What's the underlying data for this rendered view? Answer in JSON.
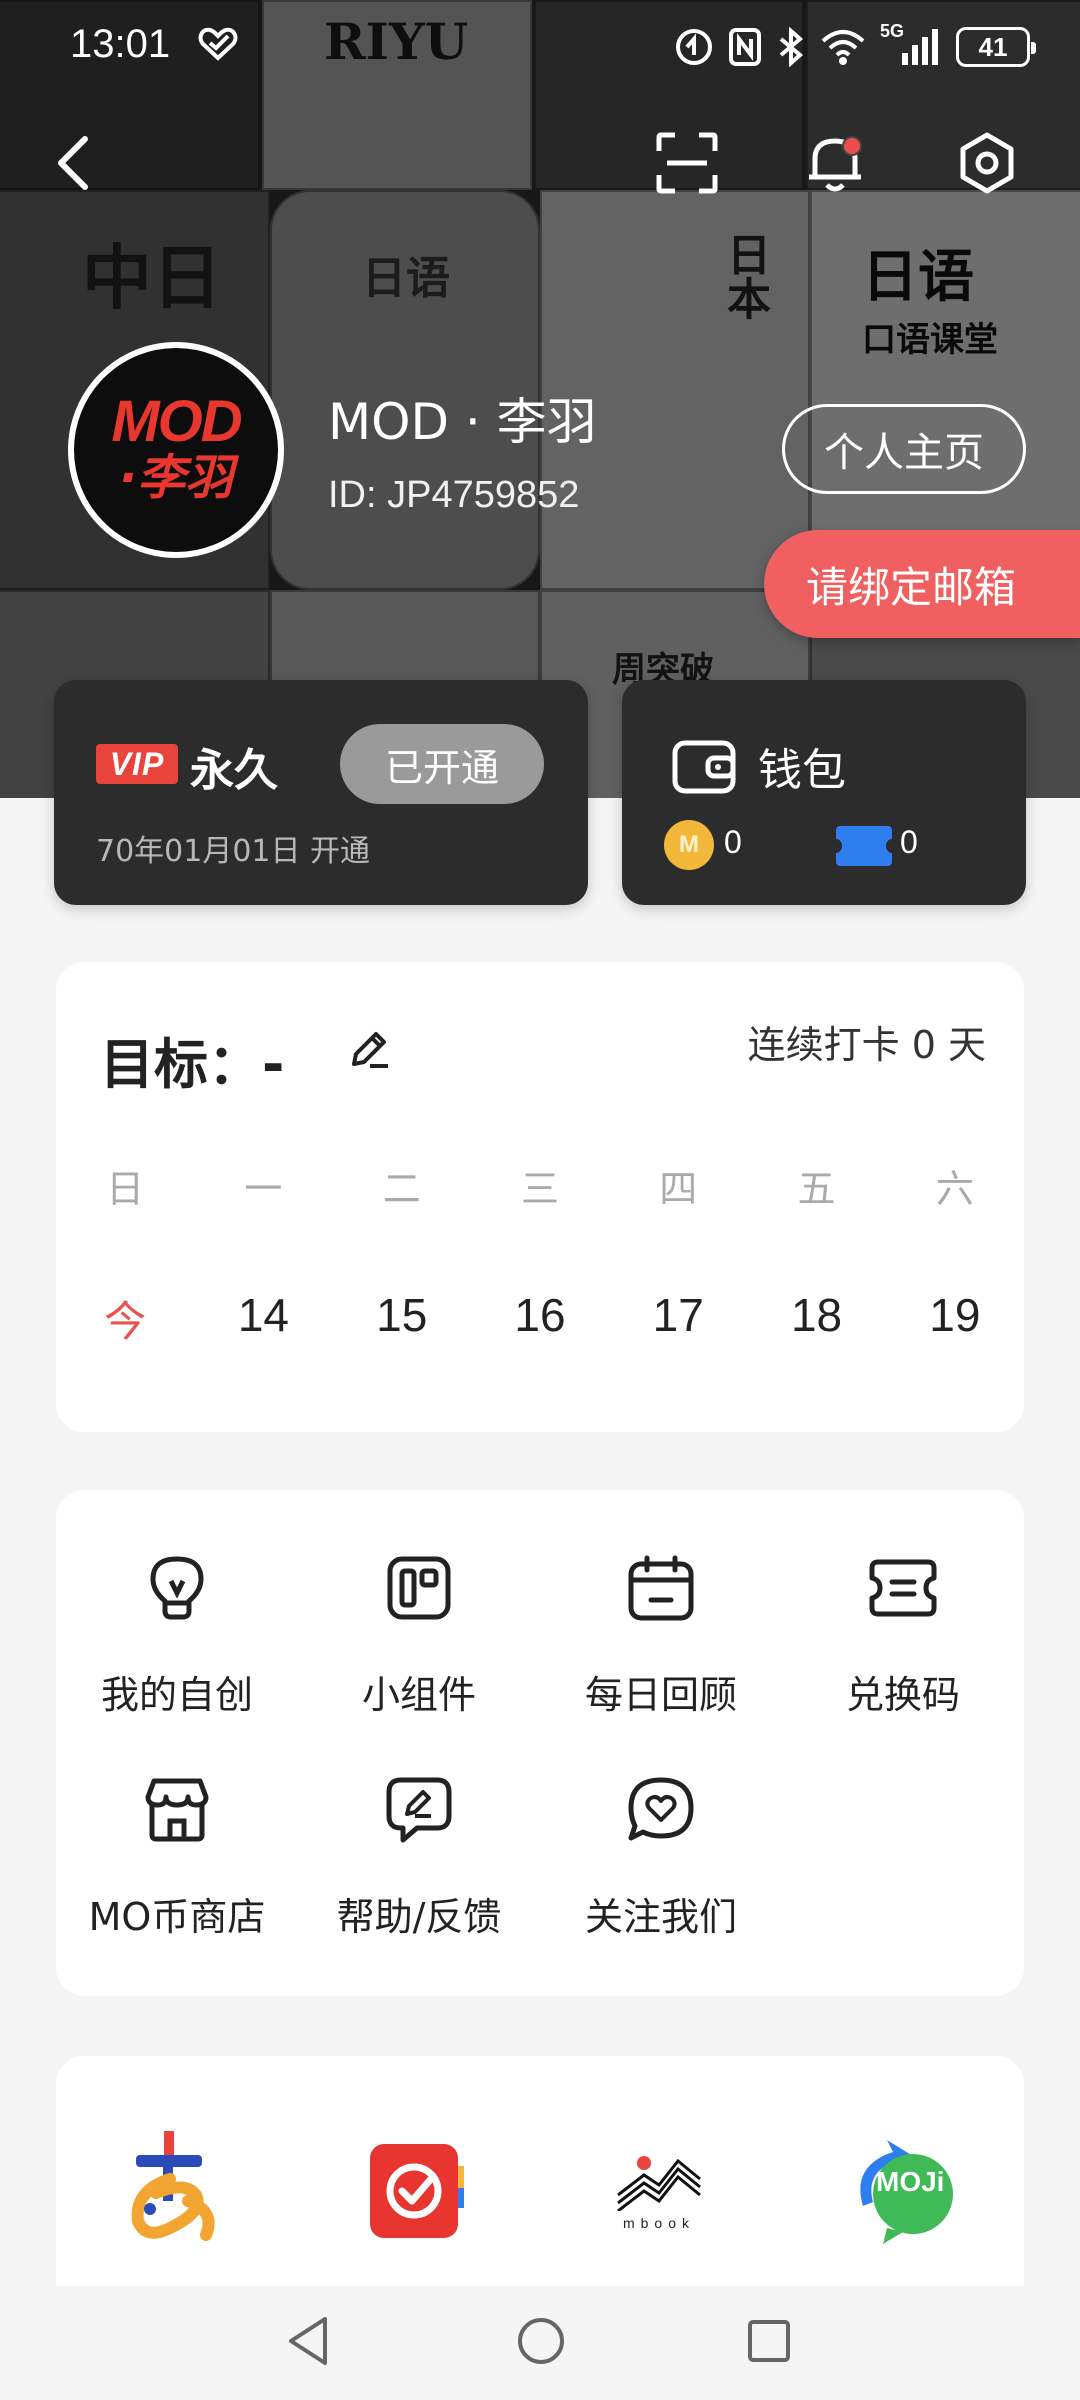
{
  "status_bar": {
    "time": "13:01",
    "network": "5G",
    "battery": "41"
  },
  "profile": {
    "avatar_line1": "MOD",
    "avatar_line2": "·李羽",
    "name": "MOD · 李羽",
    "id": "ID: JP4759852",
    "homepage_button": "个人主页",
    "bind_email_button": "请绑定邮箱"
  },
  "background_covers": [
    "RIYU",
    "日语",
    "中日",
    "日本",
    "日语",
    "口语课堂",
    "周突破"
  ],
  "vip": {
    "badge": "VIP",
    "term": "永久",
    "status": "已开通",
    "activation": "70年01月01日 开通"
  },
  "wallet": {
    "title": "钱包",
    "coin_symbol": "M",
    "coins": "0",
    "tickets": "0"
  },
  "goal": {
    "title": "目标：",
    "value": "-",
    "streak": "连续打卡 0 天",
    "weekdays": [
      "日",
      "一",
      "二",
      "三",
      "四",
      "五",
      "六"
    ],
    "dates": [
      "今",
      "14",
      "15",
      "16",
      "17",
      "18",
      "19"
    ]
  },
  "features": [
    {
      "label": "我的自创",
      "icon": "lightbulb-icon"
    },
    {
      "label": "小组件",
      "icon": "widget-icon"
    },
    {
      "label": "每日回顾",
      "icon": "calendar-icon"
    },
    {
      "label": "兑换码",
      "icon": "ticket-icon"
    },
    {
      "label": "MO币商店",
      "icon": "store-icon"
    },
    {
      "label": "帮助/反馈",
      "icon": "feedback-icon"
    },
    {
      "label": "关注我们",
      "icon": "heart-chat-icon"
    }
  ],
  "apps": [
    {
      "name": "japanese-kana-app"
    },
    {
      "name": "todo-check-app"
    },
    {
      "name": "mbook-app",
      "label": "mbook"
    },
    {
      "name": "moji-app",
      "label": "MOJi"
    }
  ],
  "colors": {
    "accent_red": "#e8544c",
    "email_button": "#f06060",
    "card_dark": "#2c2c2c",
    "vip_badge": "#e8443b",
    "ticket_blue": "#2f7ef0",
    "coin_gold": "#f3b73a"
  }
}
